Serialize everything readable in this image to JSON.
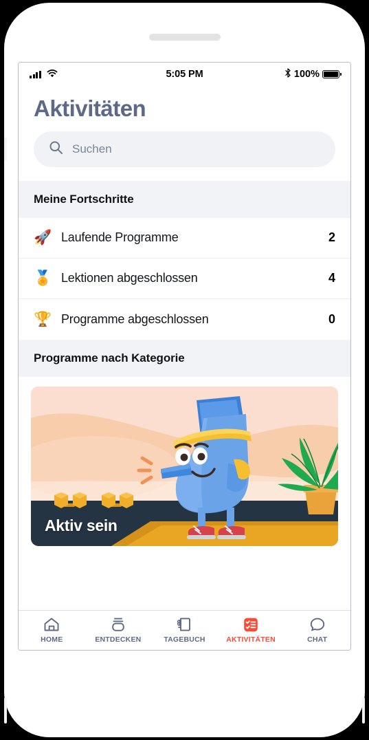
{
  "status_bar": {
    "signal_icon": "cellular-signal-icon",
    "wifi_icon": "wifi-icon",
    "time": "5:05 PM",
    "bluetooth_icon": "bluetooth-icon",
    "battery_percent": "100%",
    "battery_icon": "battery-full-icon"
  },
  "header": {
    "title": "Aktivitäten",
    "title_color": "#5d6987"
  },
  "search": {
    "icon": "search-icon",
    "placeholder": "Suchen",
    "value": ""
  },
  "progress_section": {
    "heading": "Meine Fortschritte",
    "rows": [
      {
        "emoji": "🚀",
        "icon_name": "rocket-emoji",
        "label": "Laufende Programme",
        "value": "2"
      },
      {
        "emoji": "🏅",
        "icon_name": "medal-emoji",
        "label": "Lektionen abgeschlossen",
        "value": "4"
      },
      {
        "emoji": "🏆",
        "icon_name": "trophy-emoji",
        "label": "Programme abgeschlossen",
        "value": "0"
      }
    ]
  },
  "category_section": {
    "heading": "Programme nach Kategorie",
    "cards": [
      {
        "title": "Aktiv sein",
        "illustration": "blue-character-exercising-with-dumbbells-and-plant",
        "bg_color": "#f7cba8"
      }
    ]
  },
  "tabbar": {
    "accent_color": "#fb4b38",
    "inactive_color": "#5d6987",
    "items": [
      {
        "label": "HOME",
        "icon": "home-icon",
        "active": false
      },
      {
        "label": "ENTDECKEN",
        "icon": "discover-icon",
        "active": false
      },
      {
        "label": "TAGEBUCH",
        "icon": "notebook-icon",
        "active": false
      },
      {
        "label": "AKTIVITÄTEN",
        "icon": "checklist-icon",
        "active": true
      },
      {
        "label": "CHAT",
        "icon": "chat-bubble-icon",
        "active": false
      }
    ]
  }
}
